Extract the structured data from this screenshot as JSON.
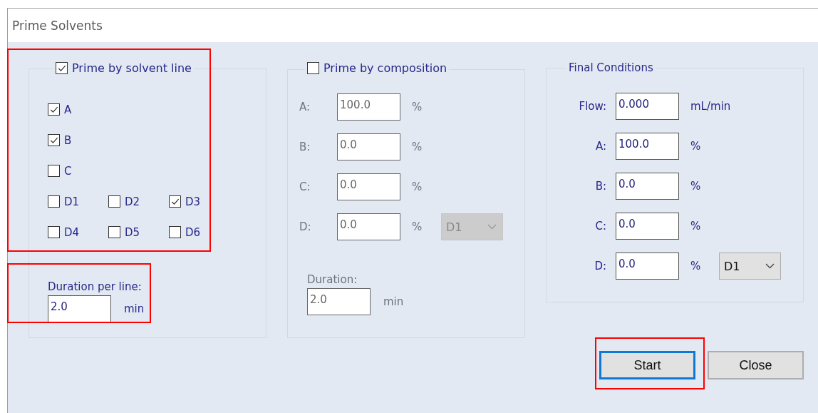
{
  "window": {
    "title": "Prime Solvents"
  },
  "solvent_line_group": {
    "label": "Prime by solvent line",
    "checked": true,
    "highlighted": true,
    "rows": [
      {
        "items": [
          {
            "label": "A",
            "checked": true
          }
        ]
      },
      {
        "items": [
          {
            "label": "B",
            "checked": true
          }
        ]
      },
      {
        "items": [
          {
            "label": "C",
            "checked": false
          }
        ]
      },
      {
        "items": [
          {
            "label": "D1",
            "checked": false
          },
          {
            "label": "D2",
            "checked": false
          },
          {
            "label": "D3",
            "checked": true
          }
        ]
      },
      {
        "items": [
          {
            "label": "D4",
            "checked": false
          },
          {
            "label": "D5",
            "checked": false
          },
          {
            "label": "D6",
            "checked": false
          }
        ]
      }
    ],
    "duration": {
      "label": "Duration per line:",
      "value": "2.0",
      "unit": "min",
      "disabled": false,
      "highlighted": true
    }
  },
  "composition_group": {
    "label": "Prime by composition",
    "checked": false,
    "fields": [
      {
        "label": "A:",
        "value": "100.0",
        "unit": "%",
        "disabled": true
      },
      {
        "label": "B:",
        "value": "0.0",
        "unit": "%",
        "disabled": true
      },
      {
        "label": "C:",
        "value": "0.0",
        "unit": "%",
        "disabled": true
      },
      {
        "label": "D:",
        "value": "0.0",
        "unit": "%",
        "disabled": true,
        "dropdown": {
          "value": "D1",
          "disabled": true
        }
      }
    ],
    "duration": {
      "label": "Duration:",
      "value": "2.0",
      "unit": "min",
      "disabled": true
    }
  },
  "final_conditions": {
    "label": "Final Conditions",
    "fields": [
      {
        "label": "Flow:",
        "value": "0.000",
        "unit": "mL/min",
        "disabled": false
      },
      {
        "label": "A:",
        "value": "100.0",
        "unit": "%",
        "disabled": false
      },
      {
        "label": "B:",
        "value": "0.0",
        "unit": "%",
        "disabled": false
      },
      {
        "label": "C:",
        "value": "0.0",
        "unit": "%",
        "disabled": false
      },
      {
        "label": "D:",
        "value": "0.0",
        "unit": "%",
        "disabled": false,
        "dropdown": {
          "value": "D1",
          "disabled": false
        }
      }
    ]
  },
  "buttons": [
    {
      "label": "Start",
      "focused": true,
      "highlighted": true
    },
    {
      "label": "Close",
      "focused": false,
      "highlighted": false
    }
  ]
}
